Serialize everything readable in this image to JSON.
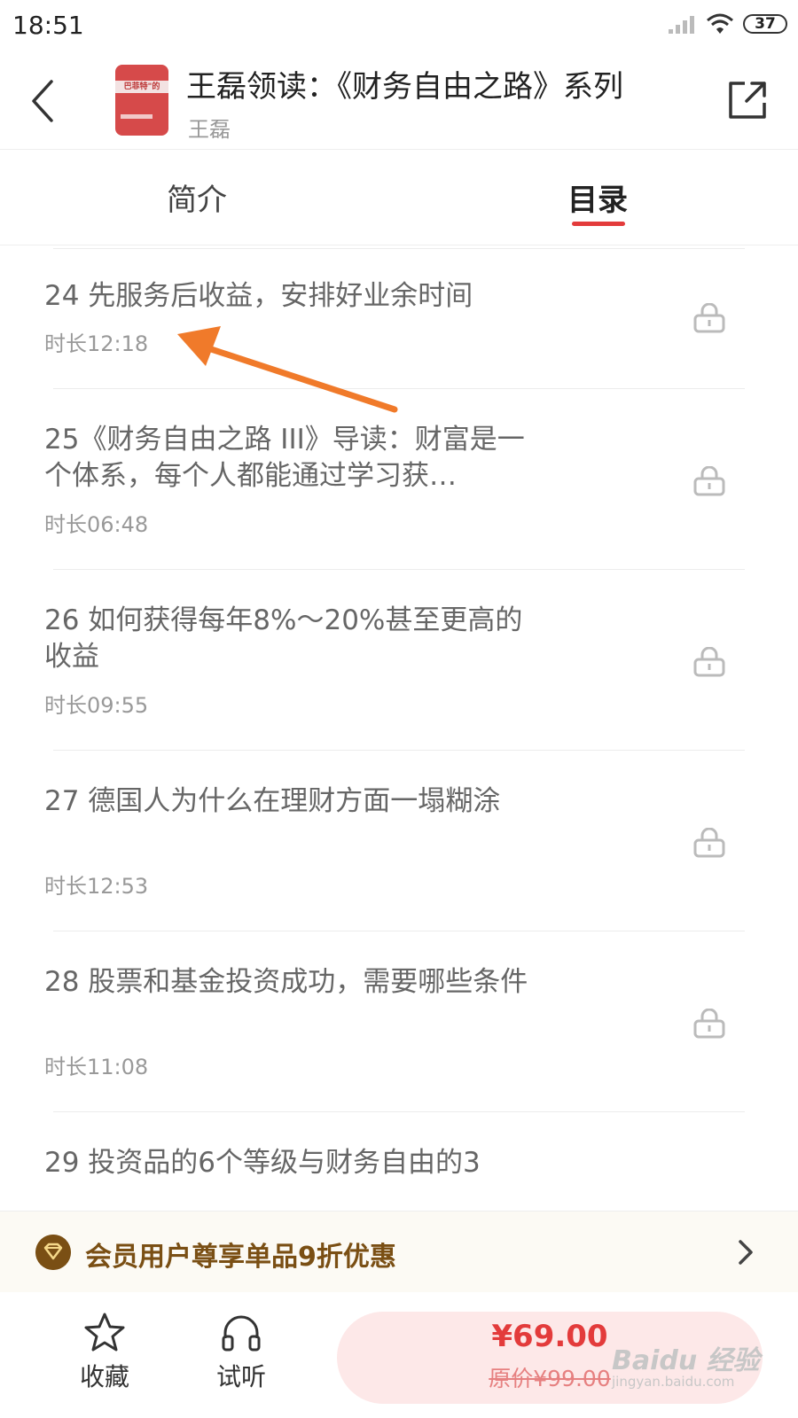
{
  "status_bar": {
    "time": "18:51",
    "battery": "37"
  },
  "header": {
    "title": "王磊领读：《财务自由之路》系列",
    "author": "王磊",
    "cover_text": "巴菲特\"的"
  },
  "tabs": [
    {
      "label": "简介",
      "active": false
    },
    {
      "label": "目录",
      "active": true
    }
  ],
  "episodes": [
    {
      "title": "24 先服务后收益，安排好业余时间",
      "duration": "时长12:18",
      "locked": true
    },
    {
      "title": "25《财务自由之路 III》导读：财富是一个体系，每个人都能通过学习获…",
      "duration": "时长06:48",
      "locked": true
    },
    {
      "title": "26 如何获得每年8%～20%甚至更高的收益",
      "duration": "时长09:55",
      "locked": true
    },
    {
      "title": "27 德国人为什么在理财方面一塌糊涂",
      "duration": "时长12:53",
      "locked": true
    },
    {
      "title": "28 股票和基金投资成功，需要哪些条件",
      "duration": "时长11:08",
      "locked": true
    },
    {
      "title": "29 投资品的6个等级与财务自由的3",
      "duration": "",
      "locked": false
    }
  ],
  "member_bar": {
    "text": "会员用户尊享单品9折优惠"
  },
  "bottom_bar": {
    "favorite_label": "收藏",
    "listen_label": "试听",
    "price": "¥69.00",
    "original_price": "原价¥99.00"
  },
  "watermark": {
    "main": "Baidu 经验",
    "url": "jingyan.baidu.com"
  },
  "colors": {
    "accent": "#e33b3b",
    "member": "#7a4f14",
    "annotation_arrow": "#f07a2a"
  }
}
